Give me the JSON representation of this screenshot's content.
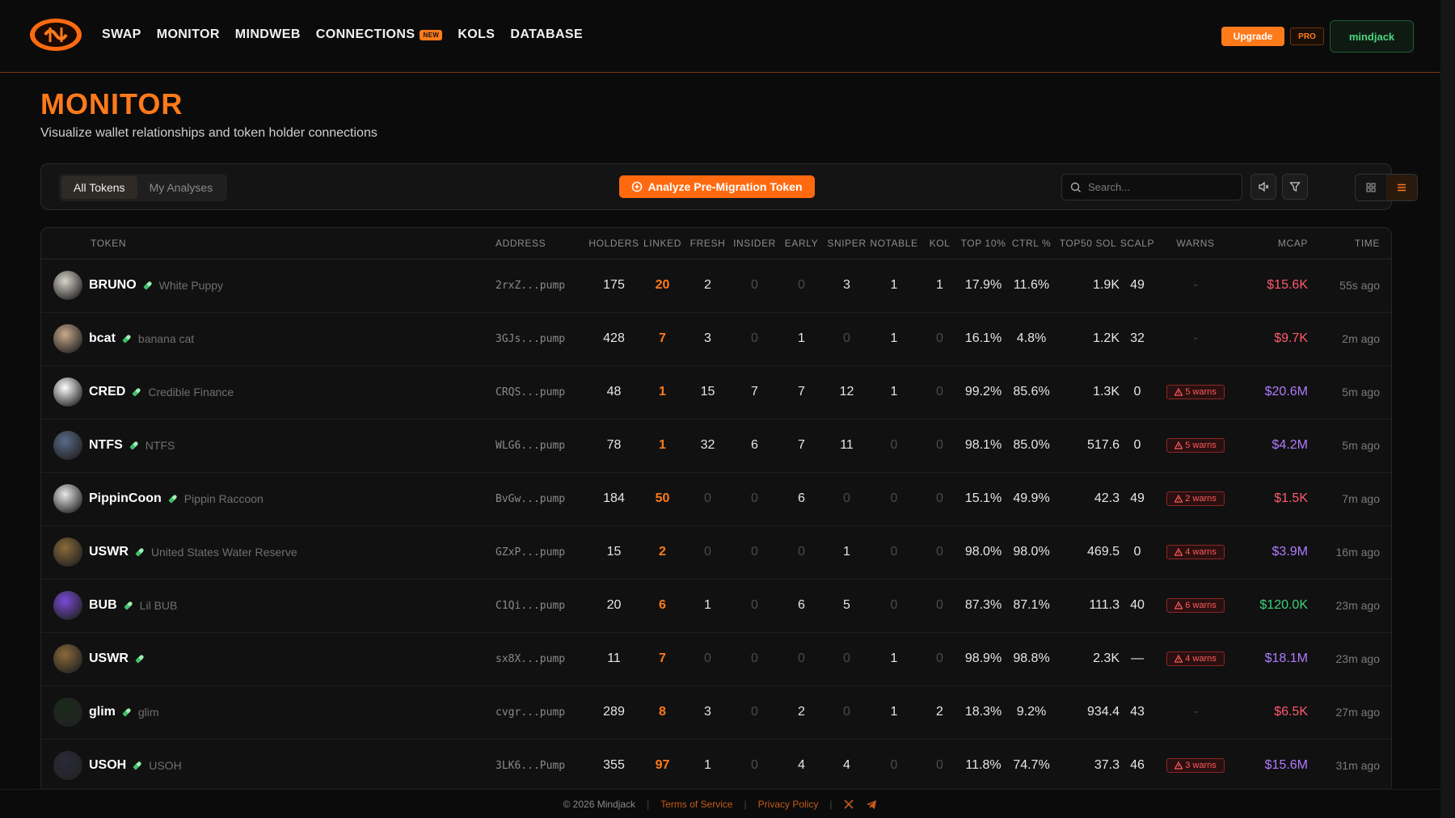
{
  "header": {
    "nav": [
      "SWAP",
      "MONITOR",
      "MINDWEB",
      "CONNECTIONS",
      "KOLS",
      "DATABASE"
    ],
    "new_badge": "NEW",
    "upgrade": "Upgrade",
    "pro": "PRO",
    "user": "mindjack"
  },
  "page": {
    "title": "MONITOR",
    "subtitle": "Visualize wallet relationships and token holder connections"
  },
  "toolbar": {
    "tabs": [
      "All Tokens",
      "My Analyses"
    ],
    "analyze": "Analyze Pre-Migration Token",
    "search_placeholder": "Search..."
  },
  "table": {
    "columns": [
      "TOKEN",
      "ADDRESS",
      "HOLDERS",
      "LINKED",
      "FRESH",
      "INSIDER",
      "EARLY",
      "SNIPER",
      "NOTABLE",
      "KOL",
      "TOP 10%",
      "CTRL %",
      "TOP50 SOL",
      "SCALP",
      "WARNS",
      "MCAP",
      "TIME"
    ],
    "rows": [
      {
        "symbol": "BRUNO",
        "name": "White Puppy",
        "address": "2rxZ...pump",
        "holders": "175",
        "linked": "20",
        "fresh": "2",
        "insider": "0",
        "early": "0",
        "sniper": "3",
        "notable": "1",
        "kol": "1",
        "top10": "17.9%",
        "ctrl": "11.6%",
        "top50sol": "1.9K",
        "scalp": "49",
        "warns": "-",
        "mcap": "$15.6K",
        "time": "55s ago",
        "mcap_color": "#ff5a6e",
        "avatar_color": "#d8d4cc"
      },
      {
        "symbol": "bcat",
        "name": "banana cat",
        "address": "3GJs...pump",
        "holders": "428",
        "linked": "7",
        "fresh": "3",
        "insider": "0",
        "early": "1",
        "sniper": "0",
        "notable": "1",
        "kol": "0",
        "top10": "16.1%",
        "ctrl": "4.8%",
        "top50sol": "1.2K",
        "scalp": "32",
        "warns": "-",
        "mcap": "$9.7K",
        "time": "2m ago",
        "mcap_color": "#ff5a6e",
        "avatar_color": "#c9a98a"
      },
      {
        "symbol": "CRED",
        "name": "Credible Finance",
        "address": "CRQS...pump",
        "holders": "48",
        "linked": "1",
        "fresh": "15",
        "insider": "7",
        "early": "7",
        "sniper": "12",
        "notable": "1",
        "kol": "0",
        "top10": "99.2%",
        "ctrl": "85.6%",
        "top50sol": "1.3K",
        "scalp": "0",
        "warns": "5 warns",
        "mcap": "$20.6M",
        "time": "5m ago",
        "mcap_color": "#b07aff",
        "avatar_color": "#ffffff"
      },
      {
        "symbol": "NTFS",
        "name": "NTFS",
        "address": "WLG6...pump",
        "holders": "78",
        "linked": "1",
        "fresh": "32",
        "insider": "6",
        "early": "7",
        "sniper": "11",
        "notable": "0",
        "kol": "0",
        "top10": "98.1%",
        "ctrl": "85.0%",
        "top50sol": "517.6",
        "scalp": "0",
        "warns": "5 warns",
        "mcap": "$4.2M",
        "time": "5m ago",
        "mcap_color": "#b07aff",
        "avatar_color": "#5a6a88"
      },
      {
        "symbol": "PippinCoon",
        "name": "Pippin Raccoon",
        "address": "BvGw...pump",
        "holders": "184",
        "linked": "50",
        "fresh": "0",
        "insider": "0",
        "early": "6",
        "sniper": "0",
        "notable": "0",
        "kol": "0",
        "top10": "15.1%",
        "ctrl": "49.9%",
        "top50sol": "42.3",
        "scalp": "49",
        "warns": "2 warns",
        "mcap": "$1.5K",
        "time": "7m ago",
        "mcap_color": "#ff5a6e",
        "avatar_color": "#e8e8e8"
      },
      {
        "symbol": "USWR",
        "name": "United States Water Reserve",
        "address": "GZxP...pump",
        "holders": "15",
        "linked": "2",
        "fresh": "0",
        "insider": "0",
        "early": "0",
        "sniper": "1",
        "notable": "0",
        "kol": "0",
        "top10": "98.0%",
        "ctrl": "98.0%",
        "top50sol": "469.5",
        "scalp": "0",
        "warns": "4 warns",
        "mcap": "$3.9M",
        "time": "16m ago",
        "mcap_color": "#b07aff",
        "avatar_color": "#8a6a3a"
      },
      {
        "symbol": "BUB",
        "name": "Lil BUB",
        "address": "C1Qi...pump",
        "holders": "20",
        "linked": "6",
        "fresh": "1",
        "insider": "0",
        "early": "6",
        "sniper": "5",
        "notable": "0",
        "kol": "0",
        "top10": "87.3%",
        "ctrl": "87.1%",
        "top50sol": "111.3",
        "scalp": "40",
        "warns": "6 warns",
        "mcap": "$120.0K",
        "time": "23m ago",
        "mcap_color": "#3fd27a",
        "avatar_color": "#7a4ad8"
      },
      {
        "symbol": "USWR",
        "name": "",
        "address": "sx8X...pump",
        "holders": "11",
        "linked": "7",
        "fresh": "0",
        "insider": "0",
        "early": "0",
        "sniper": "0",
        "notable": "1",
        "kol": "0",
        "top10": "98.9%",
        "ctrl": "98.8%",
        "top50sol": "2.3K",
        "scalp": "—",
        "warns": "4 warns",
        "mcap": "$18.1M",
        "time": "23m ago",
        "mcap_color": "#b07aff",
        "avatar_color": "#8a6a3a"
      },
      {
        "symbol": "glim",
        "name": "glim",
        "address": "cvgr...pump",
        "holders": "289",
        "linked": "8",
        "fresh": "3",
        "insider": "0",
        "early": "2",
        "sniper": "0",
        "notable": "1",
        "kol": "2",
        "top10": "18.3%",
        "ctrl": "9.2%",
        "top50sol": "934.4",
        "scalp": "43",
        "warns": "-",
        "mcap": "$6.5K",
        "time": "27m ago",
        "mcap_color": "#ff5a6e",
        "avatar_color": "#1a2a1a"
      },
      {
        "symbol": "USOH",
        "name": "USOH",
        "address": "3LK6...Pump",
        "holders": "355",
        "linked": "97",
        "fresh": "1",
        "insider": "0",
        "early": "4",
        "sniper": "4",
        "notable": "0",
        "kol": "0",
        "top10": "11.8%",
        "ctrl": "74.7%",
        "top50sol": "37.3",
        "scalp": "46",
        "warns": "3 warns",
        "mcap": "$15.6M",
        "time": "31m ago",
        "mcap_color": "#b07aff",
        "avatar_color": "#2a2a3a"
      }
    ]
  },
  "footer": {
    "copyright": "© 2026 Mindjack",
    "terms": "Terms of Service",
    "privacy": "Privacy Policy"
  },
  "colors": {
    "accent": "#ff7a1a",
    "linked": "#ff7a1a",
    "warn": "#ff5a5a",
    "user_green": "#4fd37f"
  }
}
